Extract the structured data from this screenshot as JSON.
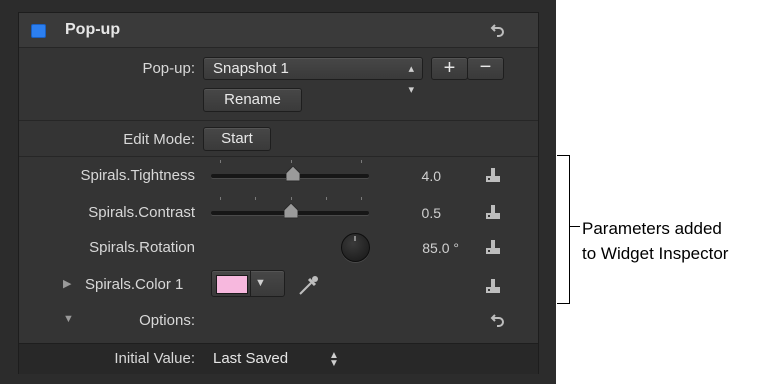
{
  "group": {
    "title": "Pop-up",
    "enabled": true
  },
  "popup_row": {
    "label": "Pop-up:",
    "value": "Snapshot 1",
    "add_label": "+",
    "remove_label": "−",
    "rename_label": "Rename"
  },
  "edit_mode": {
    "label": "Edit Mode:",
    "button_label": "Start"
  },
  "params": [
    {
      "label": "Spirals.Tightness",
      "value": "4.0"
    },
    {
      "label": "Spirals.Contrast",
      "value": "0.5"
    },
    {
      "label": "Spirals.Rotation",
      "value": "85.0 °"
    },
    {
      "label": "Spirals.Color 1",
      "color": "#f7b8de"
    }
  ],
  "options": {
    "label": "Options:"
  },
  "initial_value": {
    "label": "Initial Value:",
    "value": "Last Saved"
  },
  "annotation": {
    "line1": "Parameters added",
    "line2": "to Widget Inspector"
  },
  "colors": {
    "accent": "#2c7ff0",
    "panel_bg": "#343434",
    "swatch": "#f7b8de"
  }
}
